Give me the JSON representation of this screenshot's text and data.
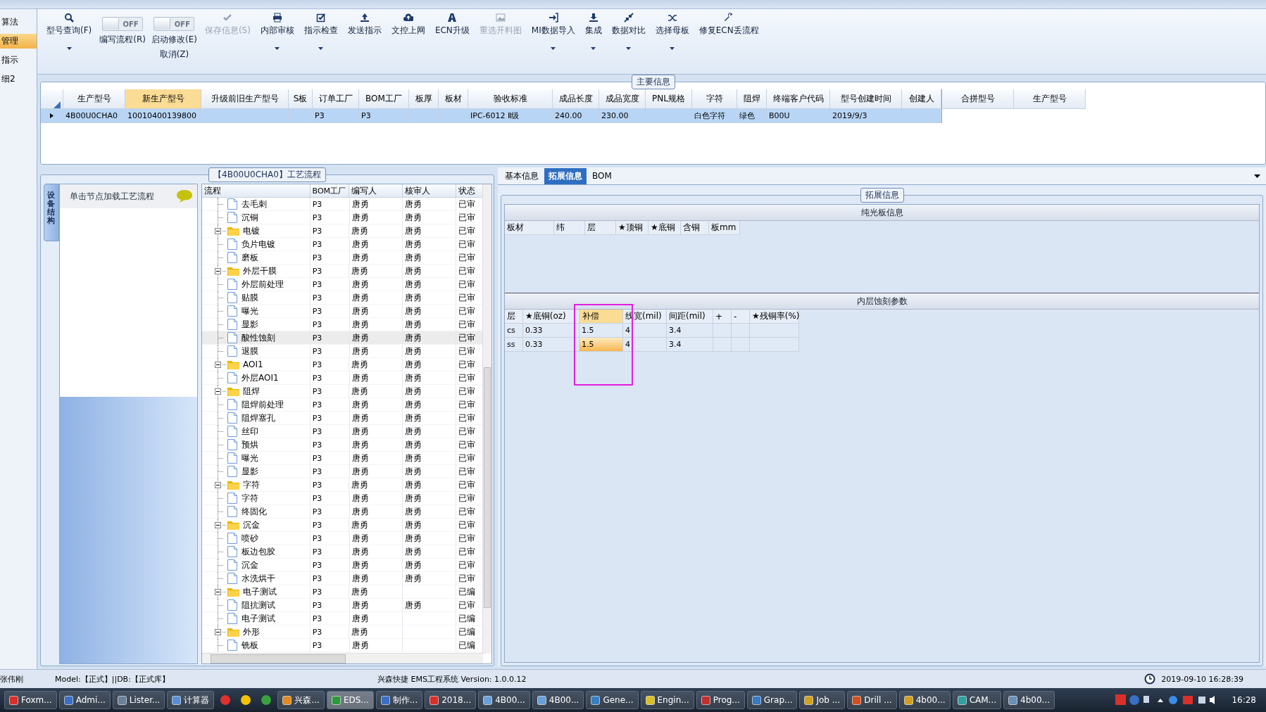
{
  "sidebar": {
    "items": [
      {
        "label": "算法",
        "selected": false
      },
      {
        "label": "管理",
        "selected": true
      },
      {
        "label": "指示",
        "selected": false
      },
      {
        "label": "细2",
        "selected": false
      }
    ]
  },
  "toolbar": [
    {
      "kind": "button",
      "label": "型号查询(F)",
      "disabled": false,
      "dropdown": true
    },
    {
      "kind": "toggle",
      "label": "编写流程(R)",
      "state_text": "OFF",
      "on": false
    },
    {
      "kind": "toggle",
      "label": "启动修改(E)",
      "label2": "取消(Z)",
      "state_text": "OFF",
      "on": false
    },
    {
      "kind": "button",
      "label": "保存信息(S)",
      "disabled": true,
      "dropdown": false
    },
    {
      "kind": "button",
      "label": "内部审核",
      "disabled": false,
      "dropdown": true
    },
    {
      "kind": "button",
      "label": "指示检查",
      "disabled": false,
      "dropdown": true
    },
    {
      "kind": "button",
      "label": "发送指示",
      "disabled": false,
      "dropdown": false
    },
    {
      "kind": "button",
      "label": "文控上网",
      "disabled": false,
      "dropdown": false
    },
    {
      "kind": "button",
      "label": "ECN升级",
      "disabled": false,
      "dropdown": false
    },
    {
      "kind": "button",
      "label": "重选开料图",
      "disabled": true,
      "dropdown": false
    },
    {
      "kind": "button",
      "label": "MI数据导入",
      "disabled": false,
      "dropdown": true
    },
    {
      "kind": "button",
      "label": "集成",
      "disabled": false,
      "dropdown": true
    },
    {
      "kind": "button",
      "label": "数据对比",
      "disabled": false,
      "dropdown": true
    },
    {
      "kind": "button",
      "label": "选择母板",
      "disabled": false,
      "dropdown": true
    },
    {
      "kind": "button",
      "label": "修复ECN丢流程",
      "disabled": false,
      "dropdown": false
    }
  ],
  "main_info": {
    "title": "主要信息",
    "columns": [
      {
        "label": "生产型号",
        "selected": false
      },
      {
        "label": "新生产型号",
        "selected": true
      },
      {
        "label": "升级前旧生产型号",
        "selected": false
      },
      {
        "label": "S板",
        "selected": false
      },
      {
        "label": "订单工厂",
        "selected": false
      },
      {
        "label": "BOM工厂",
        "selected": false
      },
      {
        "label": "板厚",
        "selected": false
      },
      {
        "label": "板材",
        "selected": false
      },
      {
        "label": "验收标准",
        "selected": false
      },
      {
        "label": "成品长度",
        "selected": false
      },
      {
        "label": "成品宽度",
        "selected": false
      },
      {
        "label": "PNL规格",
        "selected": false
      },
      {
        "label": "字符",
        "selected": false
      },
      {
        "label": "阻焊",
        "selected": false
      },
      {
        "label": "终端客户代码",
        "selected": false
      },
      {
        "label": "型号创建时间",
        "selected": false
      },
      {
        "label": "创建人",
        "selected": false
      }
    ],
    "rows": [
      {
        "selected": true,
        "cells": [
          "4B00U0CHA0",
          "10010400139800",
          null,
          null,
          "P3",
          "P3",
          null,
          null,
          "IPC-6012 Ⅱ级",
          "240.00",
          "230.00",
          null,
          "白色字符",
          "绿色",
          "B00U",
          "2019/9/3",
          null
        ]
      }
    ],
    "side_columns": [
      "合拼型号",
      "生产型号"
    ]
  },
  "process": {
    "title": "【4B00U0CHA0】工艺流程",
    "side_tab": "设备结构",
    "hint": "单击节点加载工艺流程",
    "columns": [
      "流程",
      "BOM工厂",
      "编写人",
      "核审人",
      "状态"
    ]
  },
  "tree": {
    "continued_rows": [
      {
        "name": "去毛刺",
        "bom": "P3",
        "writer": "唐勇",
        "reviewer": "唐勇",
        "status": "已审",
        "selected": false
      },
      {
        "name": "沉铜",
        "bom": "P3",
        "writer": "唐勇",
        "reviewer": "唐勇",
        "status": "已审",
        "selected": false
      }
    ],
    "groups": [
      {
        "name": "电镀",
        "bom": "P3",
        "writer": "唐勇",
        "reviewer": "唐勇",
        "status": "已审",
        "selected": false,
        "expanded": true,
        "children": [
          {
            "name": "负片电镀",
            "bom": "P3",
            "writer": "唐勇",
            "reviewer": "唐勇",
            "status": "已审",
            "selected": false
          },
          {
            "name": "磨板",
            "bom": "P3",
            "writer": "唐勇",
            "reviewer": "唐勇",
            "status": "已审",
            "selected": false
          }
        ]
      },
      {
        "name": "外层干膜",
        "bom": "P3",
        "writer": "唐勇",
        "reviewer": "唐勇",
        "status": "已审",
        "selected": false,
        "expanded": true,
        "children": [
          {
            "name": "外层前处理",
            "bom": "P3",
            "writer": "唐勇",
            "reviewer": "唐勇",
            "status": "已审",
            "selected": false
          },
          {
            "name": "贴膜",
            "bom": "P3",
            "writer": "唐勇",
            "reviewer": "唐勇",
            "status": "已审",
            "selected": false
          },
          {
            "name": "曝光",
            "bom": "P3",
            "writer": "唐勇",
            "reviewer": "唐勇",
            "status": "已审",
            "selected": false
          },
          {
            "name": "显影",
            "bom": "P3",
            "writer": "唐勇",
            "reviewer": "唐勇",
            "status": "已审",
            "selected": false
          },
          {
            "name": "酸性蚀刻",
            "bom": "P3",
            "writer": "唐勇",
            "reviewer": "唐勇",
            "status": "已审",
            "selected": true
          },
          {
            "name": "退膜",
            "bom": "P3",
            "writer": "唐勇",
            "reviewer": "唐勇",
            "status": "已审",
            "selected": false
          }
        ]
      },
      {
        "name": "AOI1",
        "bom": "P3",
        "writer": "唐勇",
        "reviewer": "唐勇",
        "status": "已审",
        "selected": false,
        "expanded": true,
        "children": [
          {
            "name": "外层AOI1",
            "bom": "P3",
            "writer": "唐勇",
            "reviewer": "唐勇",
            "status": "已审",
            "selected": false
          }
        ]
      },
      {
        "name": "阻焊",
        "bom": "P3",
        "writer": "唐勇",
        "reviewer": "唐勇",
        "status": "已审",
        "selected": false,
        "expanded": true,
        "children": [
          {
            "name": "阻焊前处理",
            "bom": "P3",
            "writer": "唐勇",
            "reviewer": "唐勇",
            "status": "已审",
            "selected": false
          },
          {
            "name": "阻焊塞孔",
            "bom": "P3",
            "writer": "唐勇",
            "reviewer": "唐勇",
            "status": "已审",
            "selected": false
          },
          {
            "name": "丝印",
            "bom": "P3",
            "writer": "唐勇",
            "reviewer": "唐勇",
            "status": "已审",
            "selected": false
          },
          {
            "name": "预烘",
            "bom": "P3",
            "writer": "唐勇",
            "reviewer": "唐勇",
            "status": "已审",
            "selected": false
          },
          {
            "name": "曝光",
            "bom": "P3",
            "writer": "唐勇",
            "reviewer": "唐勇",
            "status": "已审",
            "selected": false
          },
          {
            "name": "显影",
            "bom": "P3",
            "writer": "唐勇",
            "reviewer": "唐勇",
            "status": "已审",
            "selected": false
          }
        ]
      },
      {
        "name": "字符",
        "bom": "P3",
        "writer": "唐勇",
        "reviewer": "唐勇",
        "status": "已审",
        "selected": false,
        "expanded": true,
        "children": [
          {
            "name": "字符",
            "bom": "P3",
            "writer": "唐勇",
            "reviewer": "唐勇",
            "status": "已审",
            "selected": false
          },
          {
            "name": "终固化",
            "bom": "P3",
            "writer": "唐勇",
            "reviewer": "唐勇",
            "status": "已审",
            "selected": false
          }
        ]
      },
      {
        "name": "沉金",
        "bom": "P3",
        "writer": "唐勇",
        "reviewer": "唐勇",
        "status": "已审",
        "selected": false,
        "expanded": true,
        "children": [
          {
            "name": "喷砂",
            "bom": "P3",
            "writer": "唐勇",
            "reviewer": "唐勇",
            "status": "已审",
            "selected": false
          },
          {
            "name": "板边包胶",
            "bom": "P3",
            "writer": "唐勇",
            "reviewer": "唐勇",
            "status": "已审",
            "selected": false
          },
          {
            "name": "沉金",
            "bom": "P3",
            "writer": "唐勇",
            "reviewer": "唐勇",
            "status": "已审",
            "selected": false
          },
          {
            "name": "水洗烘干",
            "bom": "P3",
            "writer": "唐勇",
            "reviewer": "唐勇",
            "status": "已审",
            "selected": false
          }
        ]
      },
      {
        "name": "电子测试",
        "bom": "P3",
        "writer": "唐勇",
        "status": "已编",
        "selected": false,
        "expanded": true,
        "children": [
          {
            "name": "阻抗测试",
            "bom": "P3",
            "writer": "唐勇",
            "reviewer": "唐勇",
            "status": "已审",
            "selected": false
          },
          {
            "name": "电子测试",
            "bom": "P3",
            "writer": "唐勇",
            "status": "已编",
            "selected": false
          }
        ]
      },
      {
        "name": "外形",
        "bom": "P3",
        "writer": "唐勇",
        "status": "已编",
        "selected": false,
        "expanded": true,
        "children": [
          {
            "name": "铣板",
            "bom": "P3",
            "writer": "唐勇",
            "status": "已编",
            "selected": false
          }
        ]
      }
    ]
  },
  "detail_tabs": [
    {
      "label": "基本信息",
      "selected": false
    },
    {
      "label": "拓展信息",
      "selected": true
    },
    {
      "label": "BOM",
      "selected": false
    }
  ],
  "extension": {
    "title": "拓展信息",
    "bare_board": {
      "title": "纯光板信息",
      "columns": [
        "板材",
        "纬",
        "层",
        "★顶铜",
        "★底铜",
        "含铜",
        "板mm"
      ]
    },
    "inner_etch": {
      "title": "内层蚀刻参数",
      "columns": [
        {
          "label": "层",
          "selected": false
        },
        {
          "label": "★底铜(oz)",
          "selected": false
        },
        {
          "label": "补偿",
          "selected": true
        },
        {
          "label": "线宽(mil)",
          "selected": false
        },
        {
          "label": "间距(mil)",
          "selected": false
        },
        {
          "label": "+",
          "selected": false
        },
        {
          "label": "-",
          "selected": false
        },
        {
          "label": "★残铜率(%)",
          "selected": false
        }
      ],
      "rows": [
        {
          "selected": false,
          "cells": [
            "cs",
            "0.33",
            "1.5",
            "4",
            "3.4",
            null,
            null,
            null
          ]
        },
        {
          "selected": true,
          "cells": [
            "ss",
            "0.33",
            "1.5",
            "4",
            "3.4",
            null,
            null,
            null
          ]
        }
      ]
    }
  },
  "status_bar": {
    "user": "张伟刚",
    "model": "Model:【正式】||DB:【正式库】",
    "system": "兴森快捷 EMS工程系统 Version: 1.0.0.12",
    "datetime": "2019-09-10 16:28:39"
  },
  "taskbar": {
    "items": [
      {
        "kind": "app",
        "label": "Foxm...",
        "selected": false
      },
      {
        "kind": "app",
        "label": "Admi...",
        "selected": false
      },
      {
        "kind": "app",
        "label": "Lister...",
        "selected": false
      },
      {
        "kind": "app",
        "label": "计算器",
        "selected": false
      },
      {
        "kind": "icon",
        "selected": false
      },
      {
        "kind": "icon",
        "selected": false
      },
      {
        "kind": "icon",
        "selected": false
      },
      {
        "kind": "app",
        "label": "兴森...",
        "selected": false
      },
      {
        "kind": "app",
        "label": "EDS...",
        "selected": true
      },
      {
        "kind": "app",
        "label": "制作...",
        "selected": false
      },
      {
        "kind": "app",
        "label": "2018...",
        "selected": false
      },
      {
        "kind": "app",
        "label": "4B00...",
        "selected": false
      },
      {
        "kind": "app",
        "label": "4B00...",
        "selected": false
      },
      {
        "kind": "app",
        "label": "Gene...",
        "selected": false
      },
      {
        "kind": "app",
        "label": "Engin...",
        "selected": false
      },
      {
        "kind": "app",
        "label": "Prog...",
        "selected": false
      },
      {
        "kind": "app",
        "label": "Grap...",
        "selected": false
      },
      {
        "kind": "app",
        "label": "Job ...",
        "selected": false
      },
      {
        "kind": "app",
        "label": "Drill ...",
        "selected": false
      },
      {
        "kind": "app",
        "label": "4b00...",
        "selected": false
      },
      {
        "kind": "app",
        "label": "CAM...",
        "selected": false
      },
      {
        "kind": "app",
        "label": "4b00...",
        "selected": false
      }
    ],
    "time": "16:28"
  }
}
